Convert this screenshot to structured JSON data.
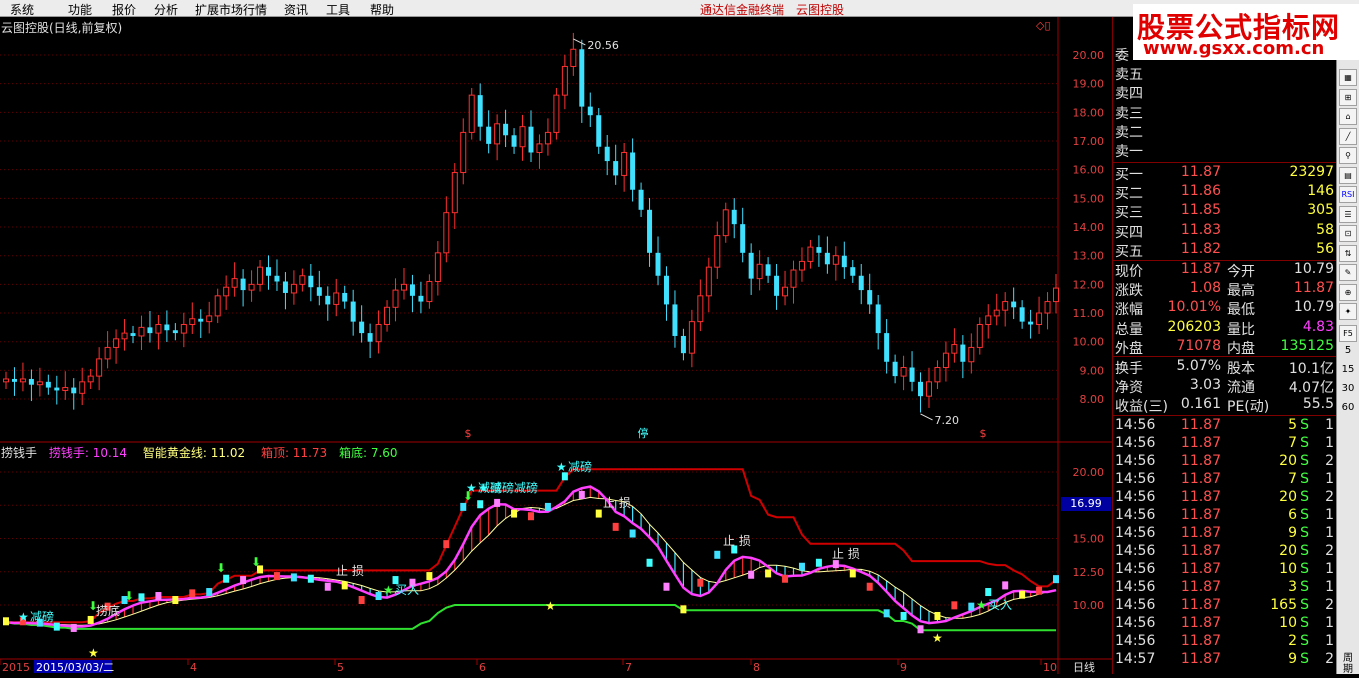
{
  "menu": {
    "items": [
      "系统",
      "功能",
      "报价",
      "分析",
      "扩展市场行情",
      "资讯",
      "工具",
      "帮助"
    ],
    "center": [
      "通达信金融终端",
      "云图控股"
    ]
  },
  "watermark": {
    "title": "股票公式指标网",
    "url": "www.gsxx.com.cn"
  },
  "chart": {
    "title": "云图控股(日线,前复权)",
    "price_ticks": [
      "20.00",
      "19.00",
      "18.00",
      "17.00",
      "16.00",
      "15.00",
      "14.00",
      "13.00",
      "12.00",
      "11.00",
      "10.00",
      "9.00",
      "8.00"
    ],
    "high_label": "20.56",
    "low_label": "7.20",
    "markers": [
      "$",
      "停",
      "$"
    ],
    "indicator": {
      "name": "捞钱手",
      "items": [
        {
          "label": "捞钱手: 10.14",
          "color": "#ff40ff"
        },
        {
          "label": "智能黄金线: 11.02",
          "color": "#ffff80"
        },
        {
          "label": "箱顶: 11.73",
          "color": "#ff4040"
        },
        {
          "label": "箱底: 7.60",
          "color": "#40ff40"
        }
      ],
      "ticks": [
        "20.00",
        "17.50",
        "15.00",
        "12.50",
        "10.00"
      ],
      "cursor_value": "16.99",
      "signals": [
        "减磅",
        "减磅",
        "减磅减磅",
        "减磅",
        "止 损",
        "止 损",
        "止 损",
        "止 损",
        "买入",
        "捞底",
        "买入"
      ]
    },
    "x_axis": {
      "ticks": [
        "2015",
        "2015/03/03/二",
        "4",
        "5",
        "6",
        "7",
        "8",
        "9",
        "10"
      ],
      "period": "日线"
    }
  },
  "chart_data": {
    "type": "candlestick",
    "title": "云图控股(日线,前复权)",
    "ylim": [
      7.5,
      20.6
    ],
    "annotated_high": 20.56,
    "annotated_low": 7.2,
    "closes": [
      8.7,
      8.6,
      8.7,
      8.5,
      8.6,
      8.4,
      8.3,
      8.4,
      8.2,
      8.6,
      8.8,
      9.4,
      9.8,
      10.1,
      10.3,
      10.2,
      10.5,
      10.3,
      10.6,
      10.4,
      10.3,
      10.6,
      10.8,
      10.7,
      10.9,
      11.6,
      11.9,
      12.2,
      11.8,
      12.0,
      12.6,
      12.3,
      12.1,
      11.7,
      12.0,
      12.3,
      11.9,
      11.6,
      11.3,
      11.7,
      11.4,
      10.7,
      10.3,
      10.0,
      10.6,
      11.2,
      11.8,
      12.0,
      11.6,
      11.4,
      12.1,
      13.1,
      14.5,
      15.9,
      17.3,
      18.6,
      17.5,
      16.9,
      17.6,
      17.2,
      16.8,
      17.5,
      16.6,
      16.9,
      17.3,
      18.6,
      19.6,
      20.2,
      18.2,
      17.9,
      16.8,
      16.3,
      15.8,
      16.6,
      15.3,
      14.6,
      13.1,
      12.3,
      11.3,
      10.2,
      9.6,
      10.7,
      11.6,
      12.6,
      13.7,
      14.6,
      14.1,
      13.1,
      12.2,
      12.7,
      12.3,
      11.6,
      11.9,
      12.5,
      12.8,
      13.3,
      13.1,
      12.7,
      13.0,
      12.6,
      12.3,
      11.8,
      11.3,
      10.3,
      9.3,
      8.8,
      9.1,
      8.6,
      8.1,
      8.6,
      9.1,
      9.6,
      9.9,
      9.3,
      9.8,
      10.6,
      10.9,
      11.1,
      11.4,
      11.2,
      10.7,
      10.6,
      11.0,
      11.4,
      11.87
    ]
  },
  "quote": {
    "sell": [
      {
        "label": "委",
        "price": "",
        "vol": ""
      },
      {
        "label": "卖五",
        "price": "",
        "vol": ""
      },
      {
        "label": "卖四",
        "price": "",
        "vol": ""
      },
      {
        "label": "卖三",
        "price": "",
        "vol": ""
      },
      {
        "label": "卖二",
        "price": "",
        "vol": ""
      },
      {
        "label": "卖一",
        "price": "",
        "vol": ""
      }
    ],
    "buy": [
      {
        "label": "买一",
        "price": "11.87",
        "vol": "23297"
      },
      {
        "label": "买二",
        "price": "11.86",
        "vol": "146"
      },
      {
        "label": "买三",
        "price": "11.85",
        "vol": "305"
      },
      {
        "label": "买四",
        "price": "11.83",
        "vol": "58"
      },
      {
        "label": "买五",
        "price": "11.82",
        "vol": "56"
      }
    ],
    "stats": [
      {
        "l1": "现价",
        "v1": "11.87",
        "c1": "r",
        "l2": "今开",
        "v2": "10.79",
        "c2": "w"
      },
      {
        "l1": "涨跌",
        "v1": "1.08",
        "c1": "r",
        "l2": "最高",
        "v2": "11.87",
        "c2": "r"
      },
      {
        "l1": "涨幅",
        "v1": "10.01%",
        "c1": "r",
        "l2": "最低",
        "v2": "10.79",
        "c2": "w"
      },
      {
        "l1": "总量",
        "v1": "206203",
        "c1": "y",
        "l2": "量比",
        "v2": "4.83",
        "c2": "m"
      },
      {
        "l1": "外盘",
        "v1": "71078",
        "c1": "r",
        "l2": "内盘",
        "v2": "135125",
        "c2": "g"
      }
    ],
    "stats2": [
      {
        "l1": "换手",
        "v1": "5.07%",
        "l2": "股本",
        "v2": "10.1亿"
      },
      {
        "l1": "净资",
        "v1": "3.03",
        "l2": "流通",
        "v2": "4.07亿"
      },
      {
        "l1": "收益(三)",
        "v1": "0.161",
        "l2": "PE(动)",
        "v2": "55.5"
      }
    ],
    "ticks": [
      {
        "t": "14:56",
        "p": "11.87",
        "v": "5",
        "s": "S",
        "n": "1"
      },
      {
        "t": "14:56",
        "p": "11.87",
        "v": "7",
        "s": "S",
        "n": "1"
      },
      {
        "t": "14:56",
        "p": "11.87",
        "v": "20",
        "s": "S",
        "n": "2"
      },
      {
        "t": "14:56",
        "p": "11.87",
        "v": "7",
        "s": "S",
        "n": "1"
      },
      {
        "t": "14:56",
        "p": "11.87",
        "v": "20",
        "s": "S",
        "n": "2"
      },
      {
        "t": "14:56",
        "p": "11.87",
        "v": "6",
        "s": "S",
        "n": "1"
      },
      {
        "t": "14:56",
        "p": "11.87",
        "v": "9",
        "s": "S",
        "n": "1"
      },
      {
        "t": "14:56",
        "p": "11.87",
        "v": "20",
        "s": "S",
        "n": "2"
      },
      {
        "t": "14:56",
        "p": "11.87",
        "v": "10",
        "s": "S",
        "n": "1"
      },
      {
        "t": "14:56",
        "p": "11.87",
        "v": "3",
        "s": "S",
        "n": "1"
      },
      {
        "t": "14:56",
        "p": "11.87",
        "v": "165",
        "s": "S",
        "n": "2"
      },
      {
        "t": "14:56",
        "p": "11.87",
        "v": "10",
        "s": "S",
        "n": "1"
      },
      {
        "t": "14:56",
        "p": "11.87",
        "v": "2",
        "s": "S",
        "n": "1"
      },
      {
        "t": "14:57",
        "p": "11.87",
        "v": "9",
        "s": "S",
        "n": "2"
      }
    ]
  },
  "toolbar": {
    "buttons": [
      "RSI"
    ],
    "numbers": [
      "5",
      "15",
      "30",
      "60"
    ],
    "f_keys": [
      "F5"
    ],
    "bottom": "周期"
  }
}
